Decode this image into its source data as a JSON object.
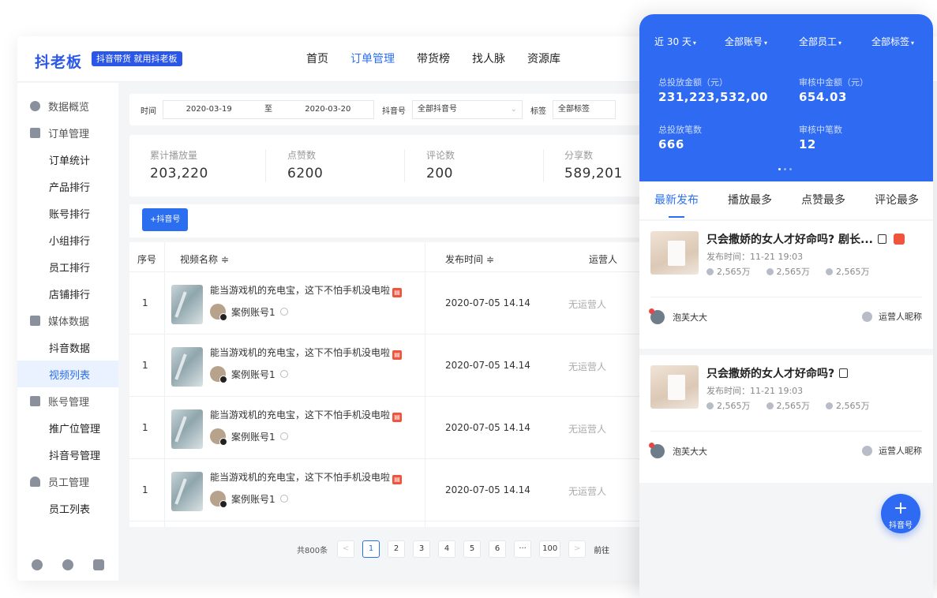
{
  "header": {
    "logo": "抖老板",
    "tag": "抖音带货 就用抖老板",
    "nav": [
      {
        "label": "首页"
      },
      {
        "label": "订单管理"
      },
      {
        "label": "带货榜"
      },
      {
        "label": "找人脉"
      },
      {
        "label": "资源库"
      }
    ]
  },
  "sidebar": {
    "data_overview": "数据概览",
    "order_mgmt": "订单管理",
    "order_items": [
      "订单统计",
      "产品排行",
      "账号排行",
      "小组排行",
      "员工排行",
      "店铺排行"
    ],
    "media_data": "媒体数据",
    "media_items": [
      "抖音数据",
      "视频列表"
    ],
    "account_mgmt": "账号管理",
    "account_items": [
      "推广位管理",
      "抖音号管理"
    ],
    "staff_mgmt": "员工管理",
    "staff_items": [
      "员工列表"
    ]
  },
  "filter": {
    "time_label": "时间",
    "date_from": "2020-03-19",
    "to_label": "至",
    "date_to": "2020-03-20",
    "account_label": "抖音号",
    "account_value": "全部抖音号",
    "tag_label": "标签",
    "tag_value": "全部标签"
  },
  "stats": [
    {
      "label": "累计播放量",
      "value": "203,220"
    },
    {
      "label": "点赞数",
      "value": "6200"
    },
    {
      "label": "评论数",
      "value": "200"
    },
    {
      "label": "分享数",
      "value": "589,201"
    }
  ],
  "add_button": "+抖音号",
  "table": {
    "columns": [
      "序号",
      "视频名称 ≑",
      "发布时间 ≑",
      "运营人"
    ],
    "rows": [
      {
        "idx": "1",
        "title": "能当游戏机的充电宝，这下不怕手机没电啦",
        "account": "案例账号1",
        "time": "2020-07-05  14.14",
        "operator": "无运营人"
      },
      {
        "idx": "1",
        "title": "能当游戏机的充电宝，这下不怕手机没电啦",
        "account": "案例账号1",
        "time": "2020-07-05  14.14",
        "operator": "无运营人"
      },
      {
        "idx": "1",
        "title": "能当游戏机的充电宝，这下不怕手机没电啦",
        "account": "案例账号1",
        "time": "2020-07-05  14.14",
        "operator": "无运营人"
      },
      {
        "idx": "1",
        "title": "能当游戏机的充电宝，这下不怕手机没电啦",
        "account": "案例账号1",
        "time": "2020-07-05  14.14",
        "operator": "无运营人"
      }
    ]
  },
  "pagination": {
    "total": "共800条",
    "prev": "<",
    "pages": [
      "1",
      "2",
      "3",
      "4",
      "5",
      "6",
      "···",
      "100"
    ],
    "next": ">",
    "goto": "前往",
    "current": "1"
  },
  "panel": {
    "filters": [
      "近 30 天",
      "全部账号",
      "全部员工",
      "全部标签"
    ],
    "caret": "▾",
    "stats": [
      {
        "label": "总投放金额（元）",
        "value": "231,223,532,00"
      },
      {
        "label": "审核中金额（元）",
        "value": "654.03"
      },
      {
        "label": "总投放笔数",
        "value": "666"
      },
      {
        "label": "审核中笔数",
        "value": "12"
      }
    ],
    "tabs": [
      "最新发布",
      "播放最多",
      "点赞最多",
      "评论最多"
    ],
    "cards": [
      {
        "title": "只会撒娇的女人才好命吗? 剧长...",
        "date": "发布时间：11-21 19:03",
        "plays": "2,565万",
        "likes": "2,565万",
        "comments": "2,565万",
        "user": "泡芙大大",
        "operator": "运营人昵称"
      },
      {
        "title": "只会撒娇的女人才好命吗?",
        "date": "发布时间：11-21 19:03",
        "plays": "2,565万",
        "likes": "2,565万",
        "comments": "2,565万",
        "user": "泡芙大大",
        "operator": "运营人昵称"
      }
    ],
    "fab_plus": "+",
    "fab_label": "抖音号"
  },
  "colors": {
    "primary": "#2f6bf2",
    "accent": "#2b6ff0",
    "cart": "#f0543c"
  }
}
